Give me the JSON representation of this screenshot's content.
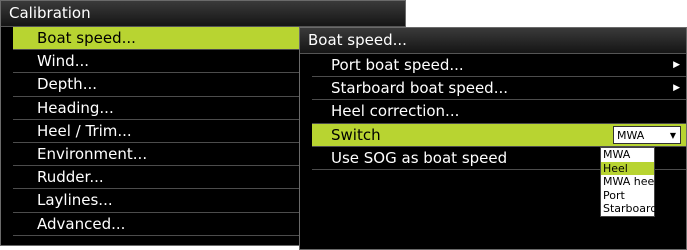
{
  "calibration": {
    "title": "Calibration",
    "items": [
      {
        "label": "Boat speed..."
      },
      {
        "label": "Wind..."
      },
      {
        "label": "Depth..."
      },
      {
        "label": "Heading..."
      },
      {
        "label": "Heel / Trim..."
      },
      {
        "label": "Environment..."
      },
      {
        "label": "Rudder..."
      },
      {
        "label": "Laylines..."
      },
      {
        "label": "Advanced..."
      }
    ]
  },
  "boat_speed": {
    "title": "Boat speed...",
    "items": [
      {
        "label": "Port boat speed...",
        "icon": "chevron-right-icon"
      },
      {
        "label": "Starboard boat speed...",
        "icon": "chevron-right-icon"
      },
      {
        "label": "Heel correction..."
      },
      {
        "label": "Switch"
      },
      {
        "label": "Use SOG as boat speed"
      }
    ],
    "switch_value": "MWA",
    "switch_options": [
      "MWA",
      "Heel",
      "MWA heel",
      "Port",
      "Starboard"
    ],
    "switch_highlighted": "Heel"
  },
  "colors": {
    "accent": "#b8d431",
    "background": "#000000",
    "text": "#ffffff"
  }
}
